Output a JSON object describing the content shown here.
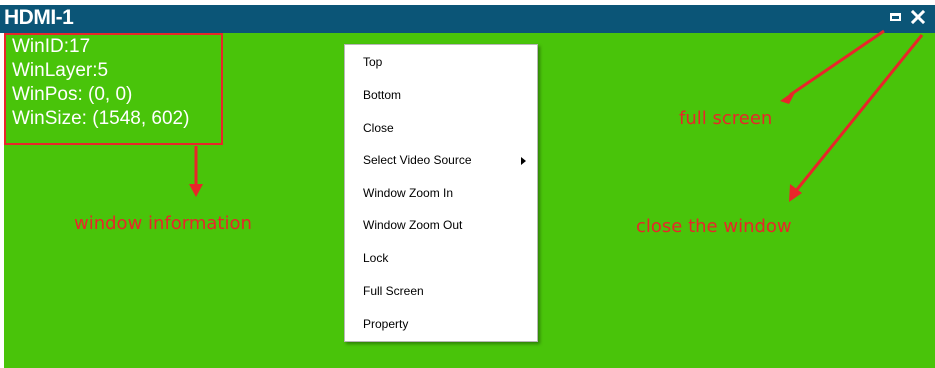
{
  "window": {
    "title": "HDMI-1",
    "maximize_icon": "maximize-icon",
    "close_icon": "close-icon"
  },
  "info": {
    "lines": [
      "WinID:17",
      "WinLayer:5",
      "WinPos: (0, 0)",
      "WinSize: (1548, 602)"
    ]
  },
  "context_menu": {
    "items": [
      {
        "label": "Top"
      },
      {
        "label": "Bottom"
      },
      {
        "label": "Close"
      },
      {
        "label": "Select Video Source",
        "submenu": true
      },
      {
        "label": "Window Zoom In"
      },
      {
        "label": "Window Zoom Out"
      },
      {
        "label": "Lock"
      },
      {
        "label": "Full Screen"
      },
      {
        "label": "Property"
      }
    ]
  },
  "annotations": {
    "window_information": "window information",
    "full_screen": "full screen",
    "close_window": "close the window"
  },
  "colors": {
    "titlebar": "#0b5577",
    "canvas": "#49c40a",
    "annotation": "#e8262a",
    "menu_background": "#ffffff"
  }
}
